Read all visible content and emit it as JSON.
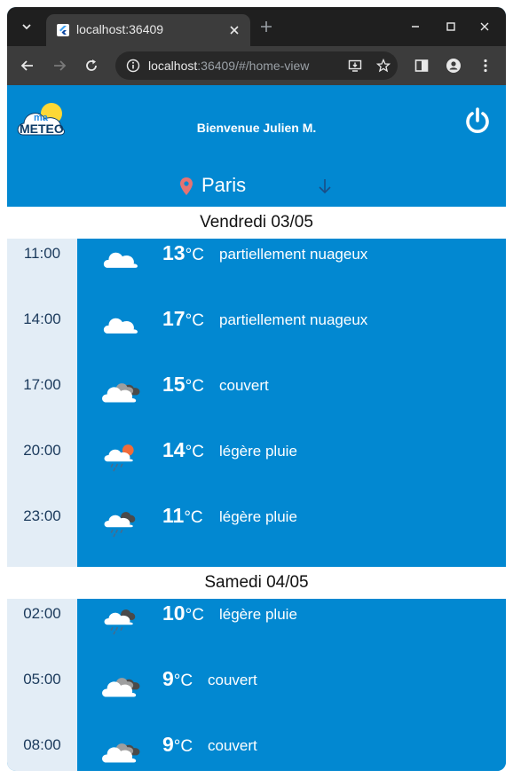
{
  "browser": {
    "tab_title": "localhost:36409",
    "url_host": "localhost",
    "url_rest": ":36409/#/home-view"
  },
  "app": {
    "logo_top": "ma",
    "logo_bottom": "METEO",
    "welcome": "Bienvenue Julien M.",
    "city": "Paris",
    "colors": {
      "primary": "#0288d1",
      "time_bg": "#e3edf6",
      "pin": "#e57373"
    }
  },
  "days": [
    {
      "label": "Vendredi 03/05",
      "entries": [
        {
          "time": "11:00",
          "temp": "13",
          "unit": "°C",
          "desc": "partiellement nuageux",
          "icon": "cloud-icon"
        },
        {
          "time": "14:00",
          "temp": "17",
          "unit": "°C",
          "desc": "partiellement nuageux",
          "icon": "cloud-icon"
        },
        {
          "time": "17:00",
          "temp": "15",
          "unit": "°C",
          "desc": "couvert",
          "icon": "overcast-icon"
        },
        {
          "time": "20:00",
          "temp": "14",
          "unit": "°C",
          "desc": "légère pluie",
          "icon": "sun-rain-icon"
        },
        {
          "time": "23:00",
          "temp": "11",
          "unit": "°C",
          "desc": "légère pluie",
          "icon": "night-rain-icon"
        }
      ]
    },
    {
      "label": "Samedi 04/05",
      "entries": [
        {
          "time": "02:00",
          "temp": "10",
          "unit": "°C",
          "desc": "légère pluie",
          "icon": "night-rain-icon"
        },
        {
          "time": "05:00",
          "temp": "9",
          "unit": "°C",
          "desc": "couvert",
          "icon": "overcast-icon"
        },
        {
          "time": "08:00",
          "temp": "9",
          "unit": "°C",
          "desc": "couvert",
          "icon": "overcast-icon"
        }
      ]
    }
  ]
}
